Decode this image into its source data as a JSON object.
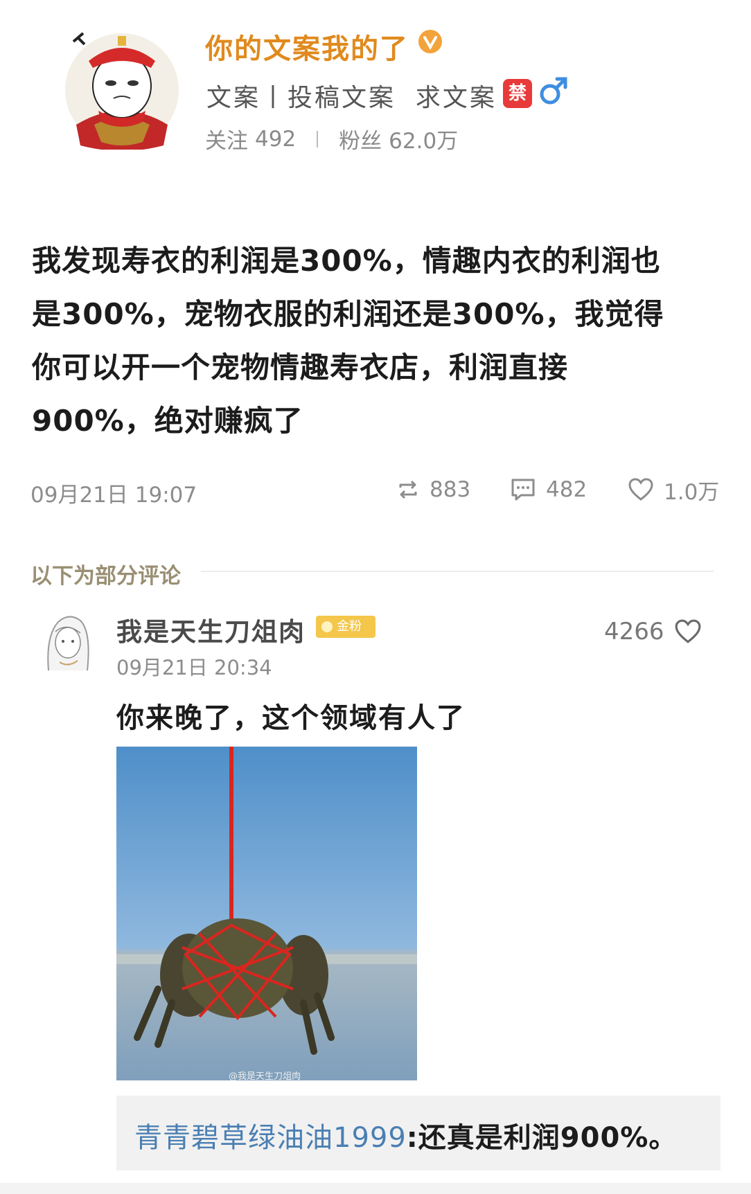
{
  "profile": {
    "nickname": "你的文案我的了",
    "bio": "文案丨投稿文案  求文案",
    "ban_badge": "禁",
    "following_label": "关注",
    "following_count": "492",
    "followers_label": "粉丝",
    "followers_count": "62.0万",
    "accent_color": "#e08a1e"
  },
  "post": {
    "lines": [
      "我发现寿衣的利润是300%，情趣内衣的利润也",
      "是300%，宠物衣服的利润还是300%，我觉得",
      "你可以开一个宠物情趣寿衣店，利润直接",
      "900%，绝对赚疯了"
    ],
    "time": "09月21日 19:07",
    "reposts": "883",
    "comments": "482",
    "likes": "1.0万"
  },
  "comments_section": {
    "label": "以下为部分评论",
    "comment": {
      "user": "我是天生刀俎肉",
      "fan_badge": "金粉",
      "time": "09月21日 20:34",
      "likes": "4266",
      "text": "你来晚了，这个领域有人了",
      "image_watermark": "@我是天生刀俎肉",
      "reply": {
        "user": "青青碧草绿油油1999",
        "text": ":还真是利润900%。"
      }
    }
  }
}
